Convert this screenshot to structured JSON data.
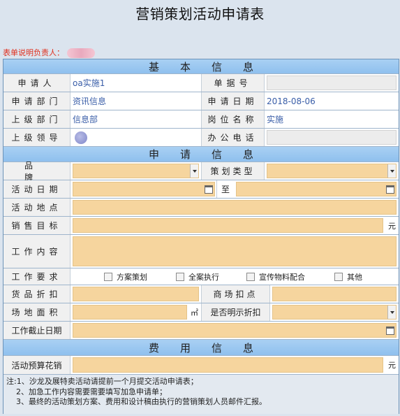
{
  "title": "营销策划活动申请表",
  "responsible_label": "表单说明负责人：",
  "basic_section": "基本信息",
  "apply_section": "申请信息",
  "cost_section": "费用信息",
  "basic": {
    "applicant_label": "申请人",
    "applicant_value": "oa实施1",
    "doc_no_label": "单据号",
    "doc_no_value": "",
    "dept_label": "申请部门",
    "dept_value": "资讯信息",
    "date_label": "申请日期",
    "date_value": "2018-08-06",
    "parent_dept_label": "上级部门",
    "parent_dept_value": "信息部",
    "position_label": "岗位名称",
    "position_value": "实施",
    "leader_label": "上级领导",
    "phone_label": "办公电话",
    "phone_value": ""
  },
  "apply": {
    "brand_label": "品牌",
    "plan_type_label": "策划类型",
    "activity_date_label": "活动日期",
    "to_label": "至",
    "location_label": "活动地点",
    "sales_target_label": "销售目标",
    "unit_yuan": "元",
    "work_content_label": "工作内容",
    "work_req_label": "工作要求",
    "options": [
      "方案策划",
      "全案执行",
      "宣传物料配合",
      "其他"
    ],
    "discount_label": "货品折扣",
    "mall_deduct_label": "商场扣点",
    "area_label": "场地面积",
    "unit_area": "㎡",
    "show_discount_label": "是否明示折扣",
    "deadline_label": "工作截止日期"
  },
  "cost": {
    "budget_label": "活动预算花销",
    "unit_yuan": "元"
  },
  "notes": [
    "注:1、沙龙及展特卖活动请提前一个月提交活动申请表；",
    "2、加急工作内容需要需要填写加急申请单；",
    "3、最终的活动策划方案、费用和设计稿由执行的营销策划人员邮件汇报。"
  ],
  "colors": {
    "section_bg": "#9fcaf2",
    "input_bg": "#f6d59e",
    "label_bg": "#f0f0f0",
    "value_text": "#3a5ea8",
    "responsible_text": "#e0301e"
  }
}
